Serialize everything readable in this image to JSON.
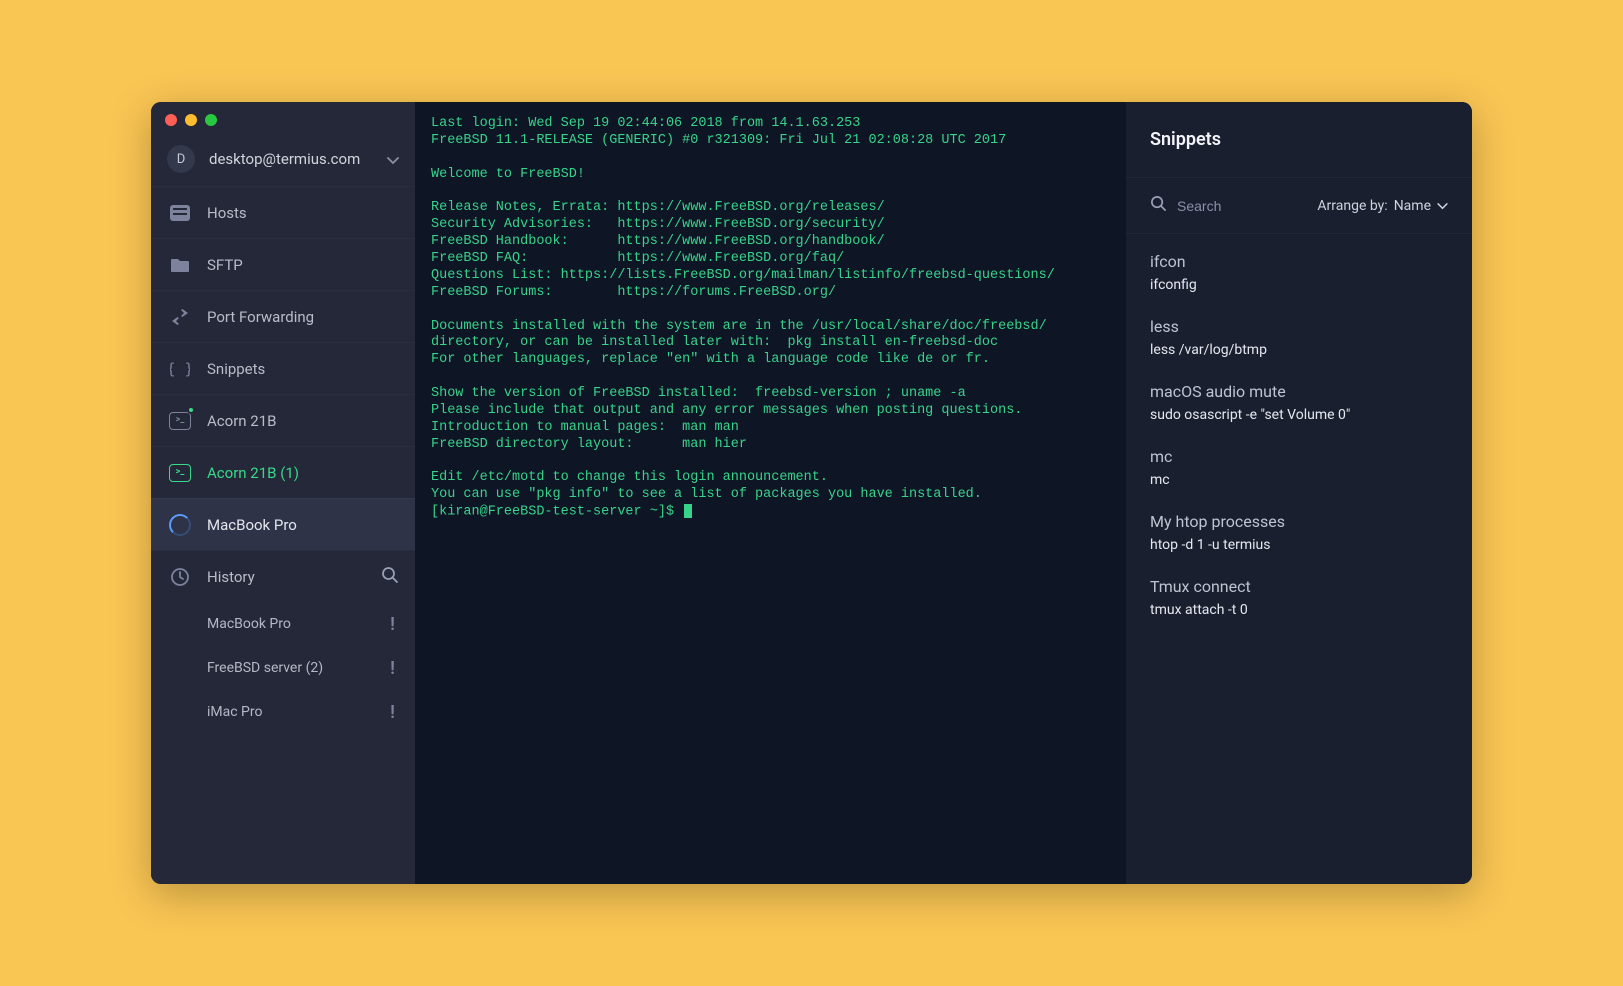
{
  "account": {
    "initial": "D",
    "label": "desktop@termius.com"
  },
  "sidebar": {
    "hosts": "Hosts",
    "sftp": "SFTP",
    "port_forwarding": "Port Forwarding",
    "snippets": "Snippets",
    "acorn_a": "Acorn 21B",
    "acorn_b": "Acorn 21B (1)",
    "macbook_pro": "MacBook Pro",
    "history": "History"
  },
  "history_items": [
    {
      "label": "MacBook Pro"
    },
    {
      "label": "FreeBSD server (2)"
    },
    {
      "label": "iMac Pro"
    }
  ],
  "terminal_text": "Last login: Wed Sep 19 02:44:06 2018 from 14.1.63.253\nFreeBSD 11.1-RELEASE (GENERIC) #0 r321309: Fri Jul 21 02:08:28 UTC 2017\n\nWelcome to FreeBSD!\n\nRelease Notes, Errata: https://www.FreeBSD.org/releases/\nSecurity Advisories:   https://www.FreeBSD.org/security/\nFreeBSD Handbook:      https://www.FreeBSD.org/handbook/\nFreeBSD FAQ:           https://www.FreeBSD.org/faq/\nQuestions List: https://lists.FreeBSD.org/mailman/listinfo/freebsd-questions/\nFreeBSD Forums:        https://forums.FreeBSD.org/\n\nDocuments installed with the system are in the /usr/local/share/doc/freebsd/\ndirectory, or can be installed later with:  pkg install en-freebsd-doc\nFor other languages, replace \"en\" with a language code like de or fr.\n\nShow the version of FreeBSD installed:  freebsd-version ; uname -a\nPlease include that output and any error messages when posting questions.\nIntroduction to manual pages:  man man\nFreeBSD directory layout:      man hier\n\nEdit /etc/motd to change this login announcement.\nYou can use \"pkg info\" to see a list of packages you have installed.",
  "terminal_prompt": "[kiran@FreeBSD-test-server ~]$ ",
  "panel": {
    "title": "Snippets",
    "search_placeholder": "Search",
    "arrange_prefix": "Arrange by:",
    "arrange_value": "Name"
  },
  "snippets": [
    {
      "title": "ifcon",
      "cmd": "ifconfig"
    },
    {
      "title": "less",
      "cmd": "less /var/log/btmp"
    },
    {
      "title": "macOS audio mute",
      "cmd": "sudo osascript -e \"set Volume 0\""
    },
    {
      "title": "mc",
      "cmd": "mc"
    },
    {
      "title": "My htop processes",
      "cmd": "htop -d 1 -u termius"
    },
    {
      "title": "Tmux connect",
      "cmd": "tmux attach -t 0"
    }
  ]
}
